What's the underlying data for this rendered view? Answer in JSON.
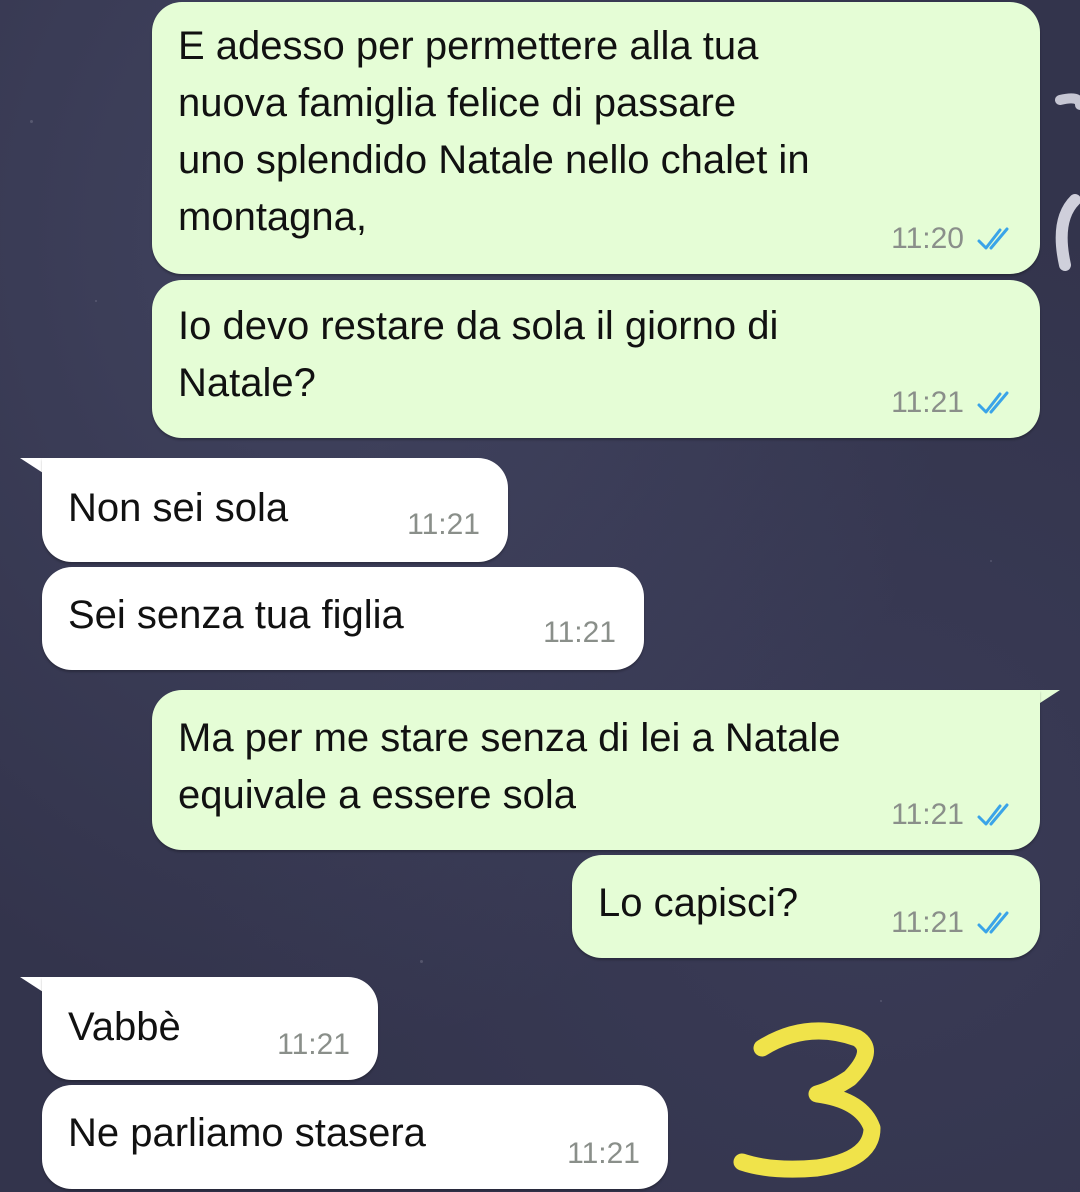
{
  "conversation": {
    "messages": [
      {
        "direction": "outgoing",
        "text": "E adesso per permettere alla tua\nnuova famiglia felice di passare\nuno splendido Natale nello chalet in\nmontagna,",
        "time": "11:20",
        "status": "read"
      },
      {
        "direction": "outgoing",
        "text": "Io devo restare da sola il giorno di\nNatale?",
        "time": "11:21",
        "status": "read"
      },
      {
        "direction": "incoming",
        "text": "Non sei sola",
        "time": "11:21"
      },
      {
        "direction": "incoming",
        "text": "Sei senza tua figlia",
        "time": "11:21"
      },
      {
        "direction": "outgoing",
        "text": "Ma per me stare senza di lei a Natale\nequivale a essere sola",
        "time": "11:21",
        "status": "read"
      },
      {
        "direction": "outgoing",
        "text": "Lo capisci?",
        "time": "11:21",
        "status": "read"
      },
      {
        "direction": "incoming",
        "text": "Vabbè",
        "time": "11:21"
      },
      {
        "direction": "incoming",
        "text": "Ne parliamo stasera",
        "time": "11:21"
      }
    ]
  },
  "annotation": {
    "number": "3",
    "color": "#f0e34a"
  },
  "colors": {
    "outgoing_bubble": "#e5fdd6",
    "incoming_bubble": "#ffffff",
    "read_ticks": "#3aa4e8",
    "timestamp": "#8a8f8a",
    "background": "#33344c"
  },
  "icons": {
    "read_receipt": "double-check-icon"
  }
}
